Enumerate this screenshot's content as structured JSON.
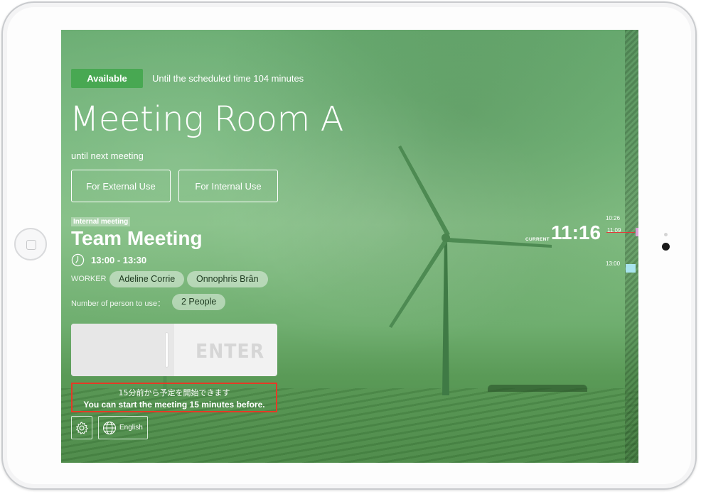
{
  "status": {
    "badge": "Available",
    "text": "Until the scheduled time 104 minutes"
  },
  "room": {
    "name": "Meeting Room A",
    "until_text": "until next meeting"
  },
  "use_buttons": {
    "external": "For External Use",
    "internal": "For Internal Use"
  },
  "meeting": {
    "tag": "Internal meeting",
    "title": "Team Meeting",
    "time": "13:00 - 13:30",
    "worker_label": "WORKER",
    "workers": [
      "Adeline Corrie",
      "Onnophris Brân"
    ],
    "persons_label": "Number of person to use：",
    "persons_value": "2 People"
  },
  "enter": {
    "label": "ENTER"
  },
  "notice": {
    "japanese": "15分前から予定を開始できます",
    "english": "You can start the meeting 15 minutes before."
  },
  "footer": {
    "language": "English"
  },
  "timeline": {
    "current_label": "CURRENT",
    "current_time": "11:16",
    "times": [
      "10:26",
      "11:09",
      "13:00"
    ]
  },
  "colors": {
    "overlay_green": "#6aad72",
    "badge_green": "#48a852",
    "notice_border": "#e53a26",
    "current_line": "#e23a3a"
  }
}
